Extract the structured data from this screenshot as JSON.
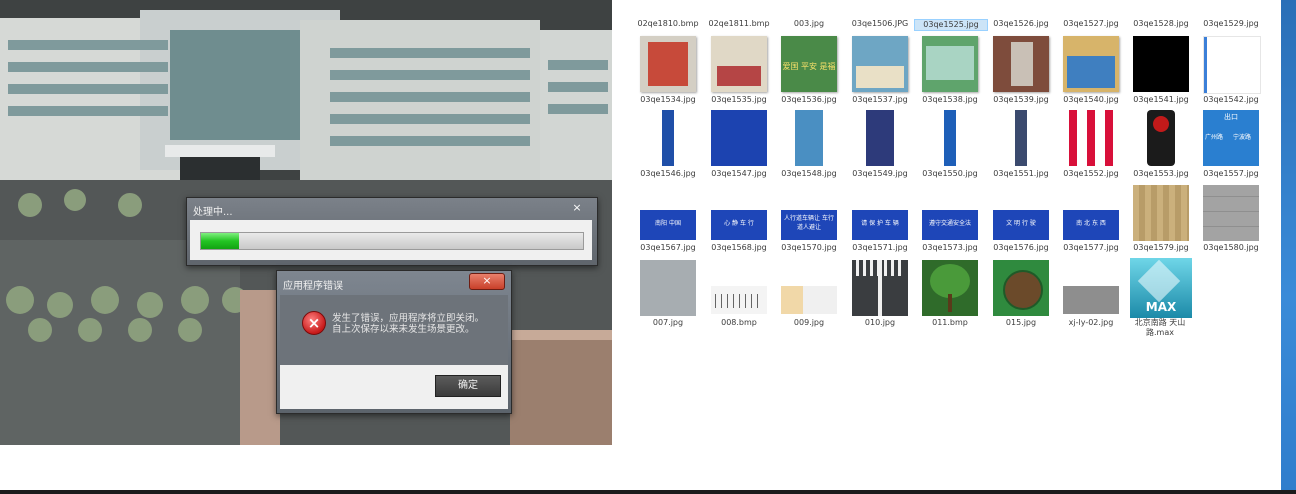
{
  "dialogs": {
    "progress": {
      "title": "处理中...",
      "close_glyph": "×",
      "progress_fraction": 0.1
    },
    "error": {
      "title": "应用程序错误",
      "close_glyph": "×",
      "message_line1": "发生了错误，应用程序将立即关闭。",
      "message_line2": "自上次保存以来未发生场景更改。",
      "ok_label": "确定",
      "icon_glyph": "×"
    }
  },
  "file_browser": {
    "top_row_labels": [
      "02qe1810.bmp",
      "02qe1811.bmp",
      "003.jpg",
      "03qe1506.JPG",
      "03qe1525.jpg",
      "03qe1526.jpg",
      "03qe1527.jpg",
      "03qe1528.jpg",
      "03qe1529.jpg"
    ],
    "selected_index": 4,
    "rows": [
      [
        "03qe1534.jpg",
        "03qe1535.jpg",
        "03qe1536.jpg",
        "03qe1537.jpg",
        "03qe1538.jpg",
        "03qe1539.jpg",
        "03qe1540.jpg",
        "03qe1541.jpg",
        "03qe1542.jpg"
      ],
      [
        "03qe1546.jpg",
        "03qe1547.jpg",
        "03qe1548.jpg",
        "03qe1549.jpg",
        "03qe1550.jpg",
        "03qe1551.jpg",
        "03qe1552.jpg",
        "03qe1553.jpg",
        "03qe1557.jpg"
      ],
      [
        "03qe1567.jpg",
        "03qe1568.jpg",
        "03qe1570.jpg",
        "03qe1571.jpg",
        "03qe1573.jpg",
        "03qe1576.jpg",
        "03qe1577.jpg",
        "03qe1579.jpg",
        "03qe1580.jpg"
      ],
      [
        "007.jpg",
        "008.bmp",
        "009.jpg",
        "010.jpg",
        "011.bmp",
        "015.jpg",
        "xj-ly-02.jpg",
        "北京南路 天山路.max"
      ]
    ],
    "thumb_text": {
      "sign_1536": "爱国 平安 是福",
      "sign_1557_exit": "出口",
      "sign_1557_left": "广州路",
      "sign_1557_right": "宁波路",
      "sign_1567": "南阳 中国",
      "sign_1568": "心 静 车 行",
      "sign_1570": "人行道车辆让 车行道人避让",
      "sign_1571": "请 保 护 车 辆",
      "sign_1573": "遵守交通安全法",
      "sign_1576": "文 明 行 驶",
      "sign_1577": "南 北 东 西",
      "max_badge": "MAX"
    }
  }
}
